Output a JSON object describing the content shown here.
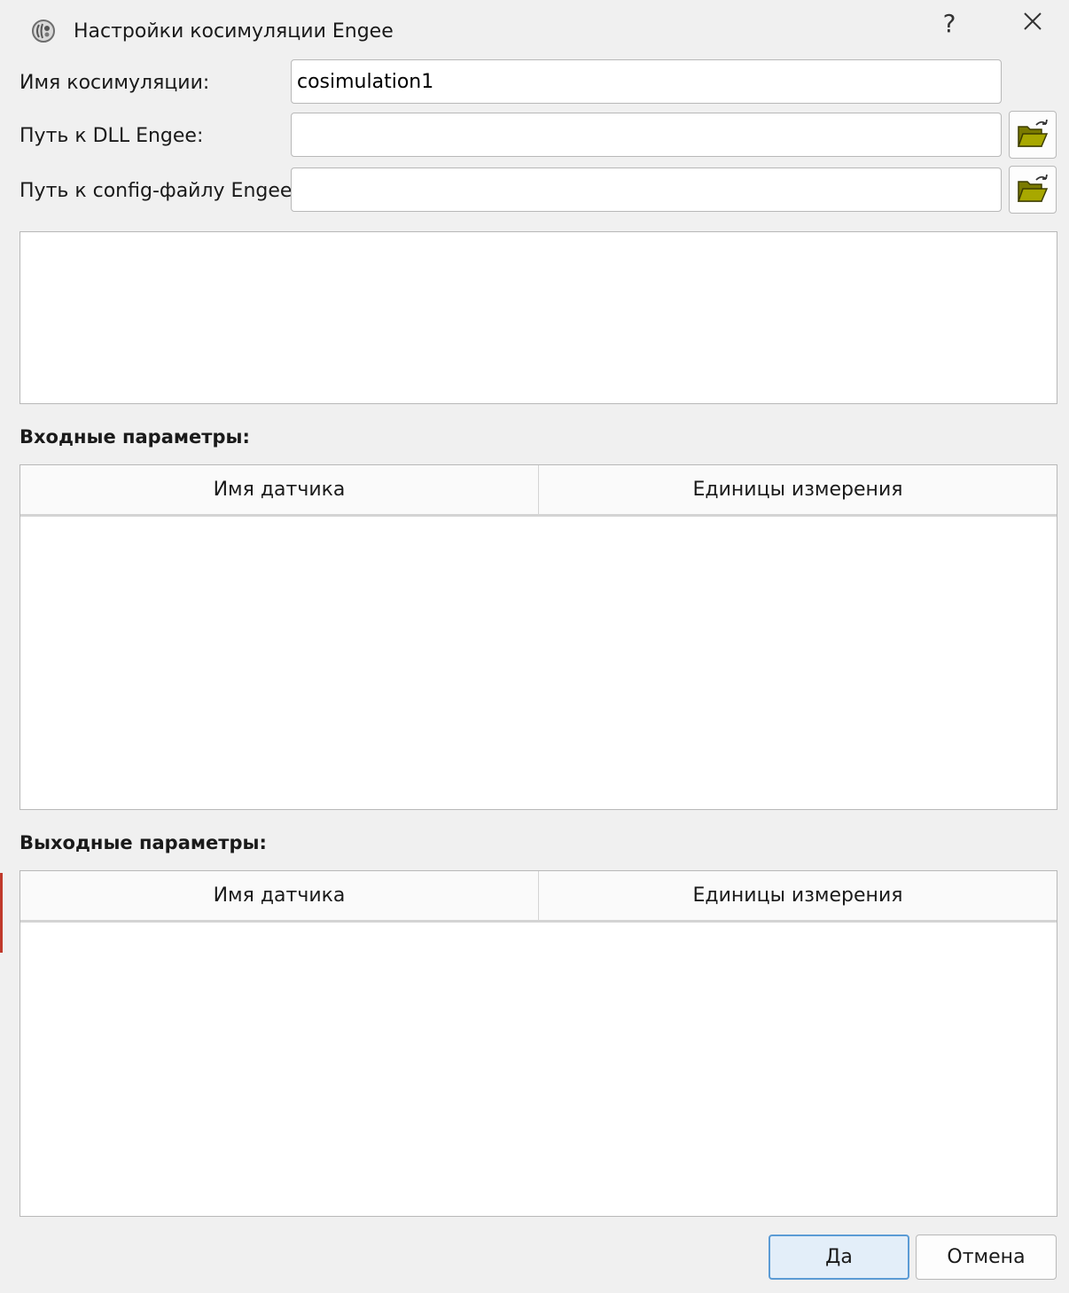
{
  "window": {
    "title": "Настройки косимуляции Engee",
    "help_glyph": "?"
  },
  "form": {
    "name_label": "Имя косимуляции:",
    "name_value": "cosimulation1",
    "dll_label": "Путь к DLL Engee:",
    "dll_value": "",
    "config_label": "Путь к config-файлу Engee:",
    "config_value": ""
  },
  "inputs_section": {
    "label": "Входные параметры:",
    "columns": [
      "Имя датчика",
      "Единицы измерения"
    ]
  },
  "outputs_section": {
    "label": "Выходные параметры:",
    "columns": [
      "Имя датчика",
      "Единицы измерения"
    ]
  },
  "buttons": {
    "ok_label": "Да",
    "cancel_label": "Отмена"
  },
  "colors": {
    "folder": "#7a7a00",
    "ok_border": "#5b9bd5",
    "ok_fill": "#e3eef9"
  }
}
